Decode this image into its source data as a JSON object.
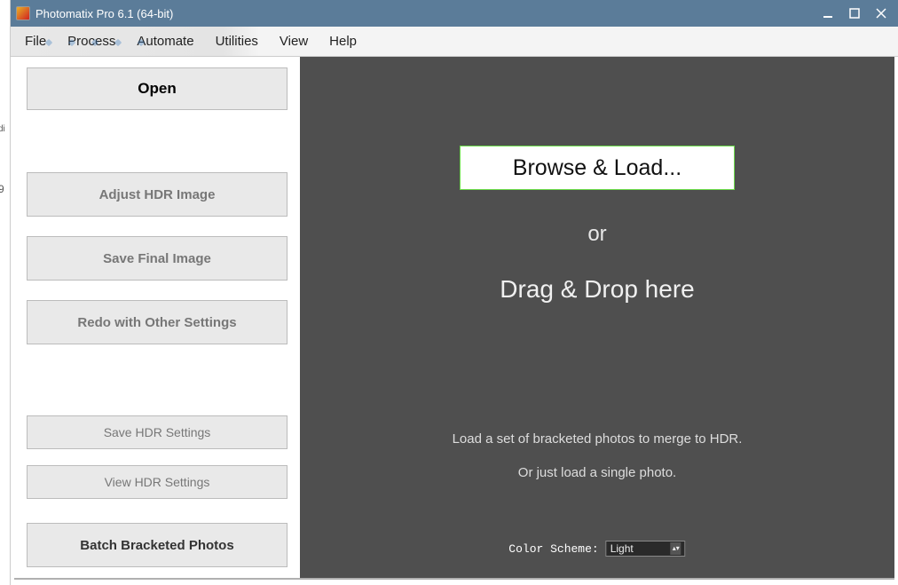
{
  "window": {
    "title": "Photomatix Pro 6.1 (64-bit)"
  },
  "menu": {
    "file": "File",
    "process": "Process",
    "automate": "Automate",
    "utilities": "Utilities",
    "view": "View",
    "help": "Help"
  },
  "sidebar": {
    "open": "Open",
    "adjust": "Adjust HDR Image",
    "save_final": "Save Final Image",
    "redo": "Redo with Other Settings",
    "save_hdr_settings": "Save HDR Settings",
    "view_hdr_settings": "View HDR Settings",
    "batch": "Batch Bracketed Photos"
  },
  "dropzone": {
    "browse": "Browse & Load...",
    "or": "or",
    "drag": "Drag & Drop here",
    "hint1": "Load a set of bracketed photos to merge to HDR.",
    "hint2": "Or just load a single photo.",
    "color_scheme_label": "Color Scheme:",
    "color_scheme_value": "Light"
  },
  "left_strip": {
    "t1": "di",
    "t2": "9"
  }
}
